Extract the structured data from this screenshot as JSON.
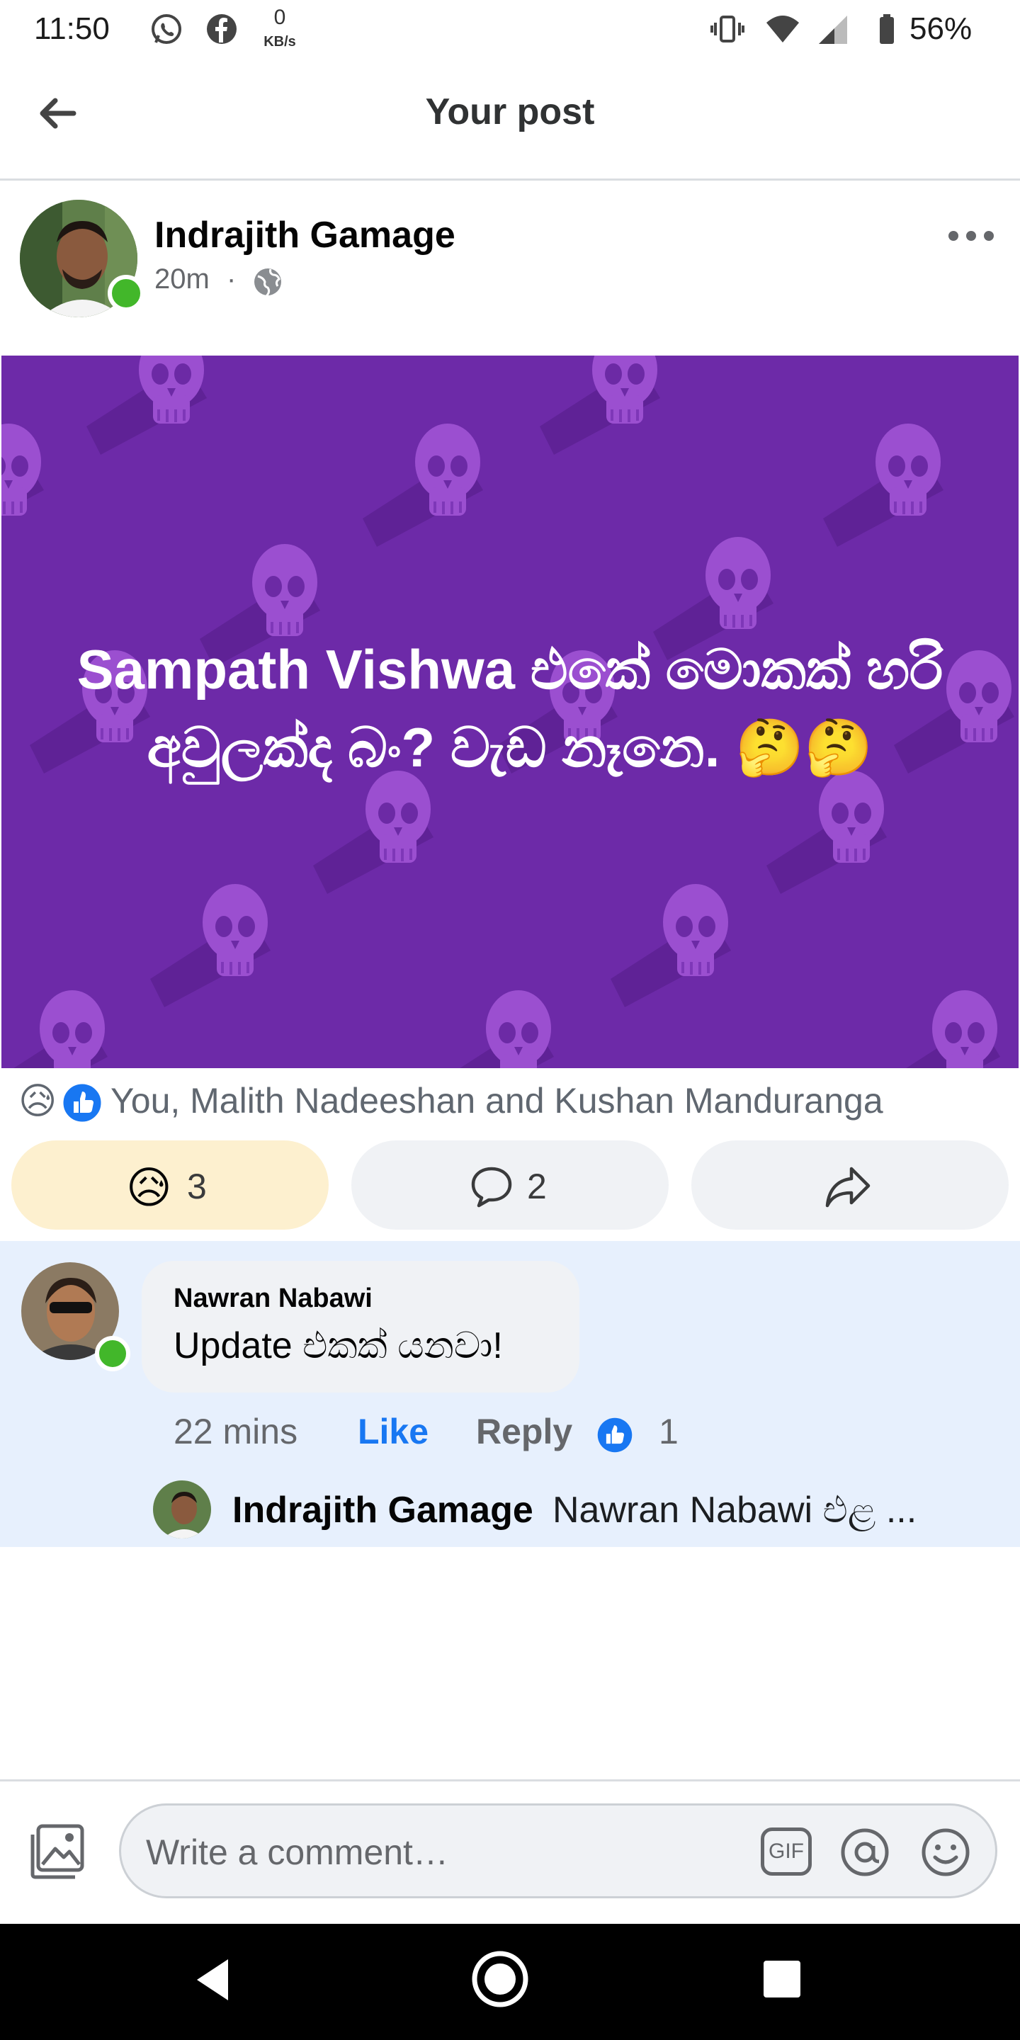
{
  "status_bar": {
    "time": "11:50",
    "net_speed_value": "0",
    "net_speed_unit": "KB/s",
    "battery": "56%",
    "icons": [
      "whatsapp-icon",
      "facebook-icon",
      "vibrate-icon",
      "wifi-icon",
      "signal-icon",
      "battery-icon"
    ]
  },
  "header": {
    "title": "Your post"
  },
  "post": {
    "author": "Indrajith Gamage",
    "time": "20m",
    "separator": "·",
    "privacy_icon": "globe-icon",
    "text": "Sampath Vishwa එකේ මොකක් හරි අවුලක්ද බං? වැඩ නෑනෙ. 🤔🤔",
    "background_color": "#6d2aa8"
  },
  "reactions": {
    "summary": "You, Malith Nadeeshan and Kushan Manduranga",
    "emojis": [
      "😥"
    ]
  },
  "actions": {
    "reaction_emoji": "😥",
    "reaction_count": "3",
    "comment_count": "2",
    "active_color": "#fdf0cf"
  },
  "comment": {
    "author": "Nawran Nabawi",
    "text": "Update එකක් යනවා!",
    "time": "22 mins",
    "like_label": "Like",
    "reply_label": "Reply",
    "like_count": "1"
  },
  "reply_preview": {
    "author": "Indrajith Gamage",
    "text": "Nawran Nabawi එළ ..."
  },
  "composer": {
    "placeholder": "Write a comment…",
    "gif_label": "GIF"
  }
}
